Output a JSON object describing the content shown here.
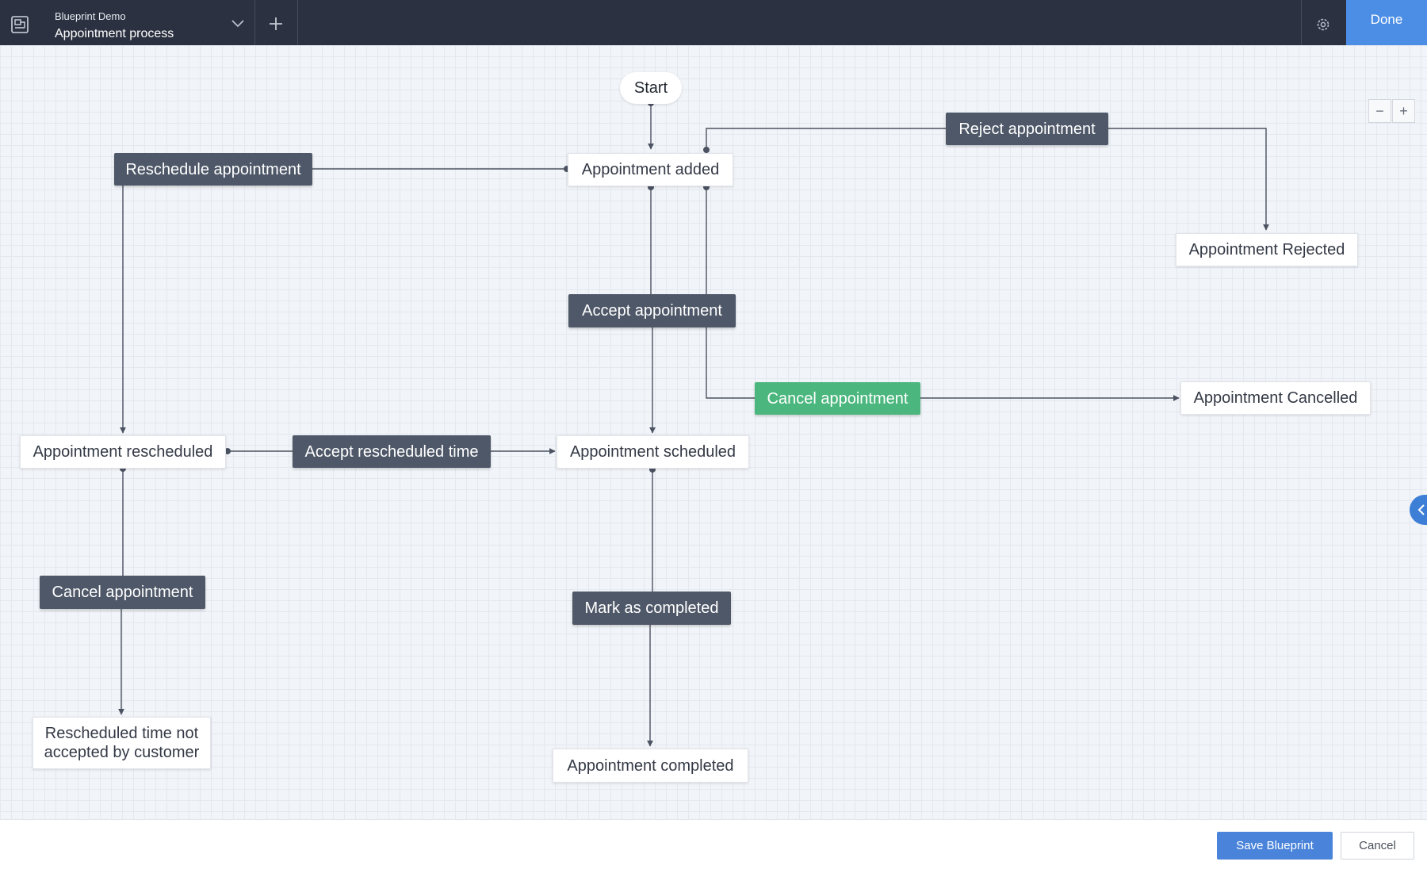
{
  "header": {
    "app_icon": "blueprint-icon",
    "subtitle": "Blueprint Demo",
    "title": "Appointment process",
    "dropdown_icon": "chevron-down-icon",
    "add_icon": "plus-icon",
    "settings_icon": "gear-icon",
    "done_label": "Done",
    "bar_color": "#2b3140",
    "done_color": "#4c8ee5"
  },
  "zoom": {
    "out_label": "−",
    "in_label": "+"
  },
  "sidebar_toggle_icon": "chevron-left-icon",
  "flow": {
    "start": "Start",
    "states": {
      "added": "Appointment added",
      "rejected": "Appointment Rejected",
      "cancelled": "Appointment Cancelled",
      "rescheduled": "Appointment rescheduled",
      "scheduled": "Appointment scheduled",
      "not_accepted": "Rescheduled time not accepted by customer",
      "completed": "Appointment completed"
    },
    "transitions": {
      "reschedule": "Reschedule appointment",
      "reject": "Reject appointment",
      "accept": "Accept appointment",
      "cancel_main": "Cancel appointment",
      "accept_rescheduled": "Accept rescheduled time",
      "cancel_rescheduled": "Cancel appointment",
      "mark_completed": "Mark as completed"
    },
    "colors": {
      "transition": "#4f5868",
      "highlight": "#4bb77e",
      "edge": "#4b5261"
    }
  },
  "footer": {
    "save_label": "Save Blueprint",
    "cancel_label": "Cancel",
    "save_color": "#4a84da"
  }
}
